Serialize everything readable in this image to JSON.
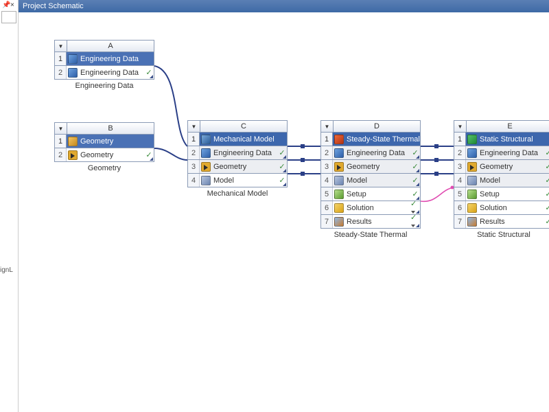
{
  "panel_title": "Project Schematic",
  "left": {
    "pin": "📌",
    "close": "×",
    "cut_text": "ignL"
  },
  "systems": {
    "A": {
      "letter": "A",
      "title": "Engineering Data",
      "title_bg": "#4a71b5",
      "title_icon": "eng",
      "caption": "Engineering Data",
      "rows": [
        {
          "n": "2",
          "icon": "eng",
          "label": "Engineering Data",
          "status": "check",
          "link": true,
          "shaded": false
        }
      ]
    },
    "B": {
      "letter": "B",
      "title": "Geometry",
      "title_bg": "#4a71b5",
      "title_icon": "geom",
      "caption": "Geometry",
      "rows": [
        {
          "n": "2",
          "icon": "geomdm",
          "label": "Geometry",
          "status": "check",
          "link": true,
          "shaded": false
        }
      ]
    },
    "C": {
      "letter": "C",
      "title": "Mechanical Model",
      "title_bg": "#3d67ad",
      "title_icon": "mech",
      "caption": "Mechanical Model",
      "rows": [
        {
          "n": "2",
          "icon": "eng",
          "label": "Engineering Data",
          "status": "check",
          "link": true,
          "shaded": true
        },
        {
          "n": "3",
          "icon": "geomdm",
          "label": "Geometry",
          "status": "check",
          "link": true,
          "shaded": true
        },
        {
          "n": "4",
          "icon": "model",
          "label": "Model",
          "status": "check",
          "link": true,
          "shaded": false
        }
      ]
    },
    "D": {
      "letter": "D",
      "title": "Steady-State Thermal",
      "title_bg": "#3d67ad",
      "title_icon": "therm",
      "caption": "Steady-State Thermal",
      "rows": [
        {
          "n": "2",
          "icon": "eng",
          "label": "Engineering Data",
          "status": "check",
          "link": true,
          "shaded": true
        },
        {
          "n": "3",
          "icon": "geomdm",
          "label": "Geometry",
          "status": "check",
          "link": true,
          "shaded": true
        },
        {
          "n": "4",
          "icon": "model",
          "label": "Model",
          "status": "check",
          "link": true,
          "shaded": true
        },
        {
          "n": "5",
          "icon": "setup",
          "label": "Setup",
          "status": "check",
          "link": true,
          "shaded": false
        },
        {
          "n": "6",
          "icon": "sol",
          "label": "Solution",
          "status": "checkcaret",
          "link": true,
          "shaded": false
        },
        {
          "n": "7",
          "icon": "res",
          "label": "Results",
          "status": "checkcaret",
          "link": true,
          "shaded": false
        }
      ]
    },
    "E": {
      "letter": "E",
      "title": "Static Structural",
      "title_bg": "#3d67ad",
      "title_icon": "struct",
      "caption": "Static Structural",
      "rows": [
        {
          "n": "2",
          "icon": "eng",
          "label": "Engineering Data",
          "status": "check",
          "link": true,
          "shaded": true
        },
        {
          "n": "3",
          "icon": "geomdm",
          "label": "Geometry",
          "status": "check",
          "link": true,
          "shaded": true
        },
        {
          "n": "4",
          "icon": "model",
          "label": "Model",
          "status": "check",
          "link": true,
          "shaded": true
        },
        {
          "n": "5",
          "icon": "setup",
          "label": "Setup",
          "status": "check",
          "link": true,
          "shaded": false
        },
        {
          "n": "6",
          "icon": "sol",
          "label": "Solution",
          "status": "check",
          "link": false,
          "shaded": false
        },
        {
          "n": "7",
          "icon": "res",
          "label": "Results",
          "status": "check",
          "link": true,
          "shaded": false
        }
      ]
    }
  }
}
